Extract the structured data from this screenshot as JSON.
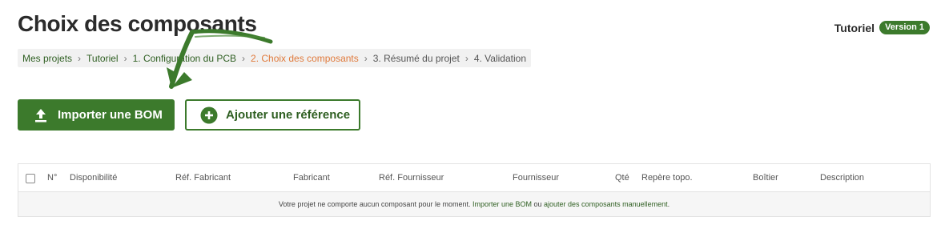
{
  "page": {
    "title": "Choix des composants"
  },
  "project": {
    "name": "Tutoriel",
    "version": "Version 1"
  },
  "breadcrumb": [
    {
      "label": "Mes projets"
    },
    {
      "label": "Tutoriel"
    },
    {
      "label": "1. Configuration du PCB"
    },
    {
      "label": "2. Choix des composants"
    },
    {
      "label": "3. Résumé du projet"
    },
    {
      "label": "4. Validation"
    }
  ],
  "breadcrumb_separator": "›",
  "actions": {
    "import_label": "Importer une BOM",
    "import_icon": "upload-icon",
    "add_label": "Ajouter une référence",
    "add_icon": "plus-circle-icon"
  },
  "table": {
    "columns": [
      "N°",
      "Disponibilité",
      "Réf. Fabricant",
      "Fabricant",
      "Réf. Fournisseur",
      "Fournisseur",
      "Qté",
      "Repère topo.",
      "Boîtier",
      "Description"
    ],
    "empty": {
      "text_before": "Votre projet ne comporte aucun composant pour le moment. ",
      "import_link": "Importer une BOM",
      "middle": " ou ",
      "add_link": "ajouter des composants manuellement",
      "text_after": "."
    }
  },
  "colors": {
    "accent": "#3c7a2c",
    "active_step": "#e07a3c"
  }
}
